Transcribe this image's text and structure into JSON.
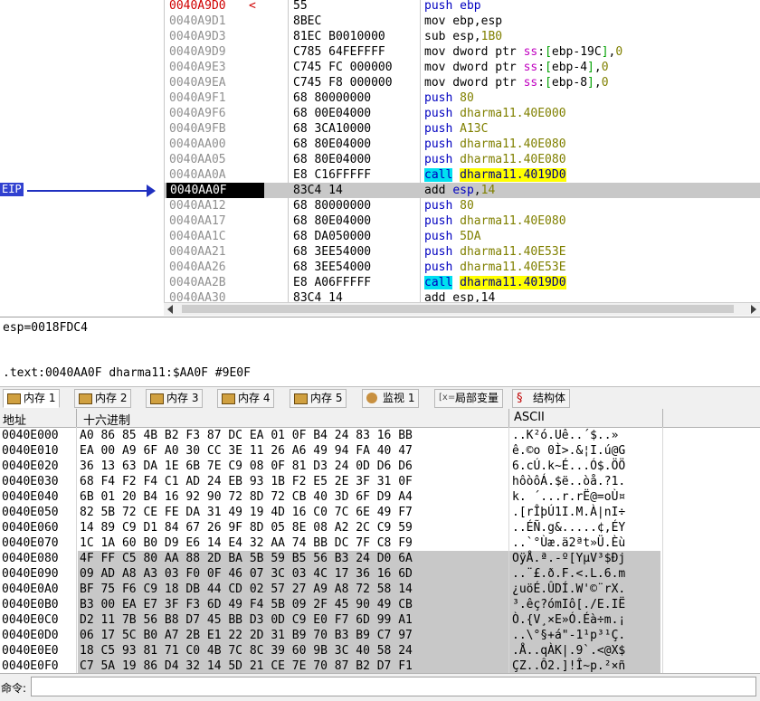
{
  "disasm": {
    "eip_label": "EIP",
    "rows": [
      {
        "addr": "0040A9D0",
        "arrow": "<",
        "bytes": "55",
        "ins": [
          [
            "kw",
            "push"
          ],
          [
            "t",
            " "
          ],
          [
            "kw",
            "ebp"
          ]
        ],
        "addr_red": true
      },
      {
        "addr": "0040A9D1",
        "bytes": "8BEC",
        "ins": [
          [
            "t",
            "mov ebp,esp"
          ]
        ]
      },
      {
        "addr": "0040A9D3",
        "bytes": "81EC B0010000",
        "ins": [
          [
            "t",
            "sub esp,"
          ],
          [
            "num",
            "1B0"
          ]
        ]
      },
      {
        "addr": "0040A9D9",
        "bytes": "C785 64FEFFFF",
        "ins": [
          [
            "t",
            "mov dword ptr "
          ],
          [
            "seg",
            "ss"
          ],
          [
            "t",
            ":"
          ],
          [
            "br",
            "["
          ],
          [
            "t",
            "ebp-19C"
          ],
          [
            "br",
            "]"
          ],
          [
            "t",
            ","
          ],
          [
            "num",
            "0"
          ]
        ]
      },
      {
        "addr": "0040A9E3",
        "bytes": "C745 FC 000000",
        "ins": [
          [
            "t",
            "mov dword ptr "
          ],
          [
            "seg",
            "ss"
          ],
          [
            "t",
            ":"
          ],
          [
            "br",
            "["
          ],
          [
            "t",
            "ebp-4"
          ],
          [
            "br",
            "]"
          ],
          [
            "t",
            ","
          ],
          [
            "num",
            "0"
          ]
        ]
      },
      {
        "addr": "0040A9EA",
        "bytes": "C745 F8 000000",
        "ins": [
          [
            "t",
            "mov dword ptr "
          ],
          [
            "seg",
            "ss"
          ],
          [
            "t",
            ":"
          ],
          [
            "br",
            "["
          ],
          [
            "t",
            "ebp-8"
          ],
          [
            "br",
            "]"
          ],
          [
            "t",
            ","
          ],
          [
            "num",
            "0"
          ]
        ]
      },
      {
        "addr": "0040A9F1",
        "bytes": "68 80000000",
        "ins": [
          [
            "kw",
            "push"
          ],
          [
            "t",
            " "
          ],
          [
            "ref",
            "80"
          ]
        ]
      },
      {
        "addr": "0040A9F6",
        "bytes": "68 00E04000",
        "ins": [
          [
            "kw",
            "push"
          ],
          [
            "t",
            " "
          ],
          [
            "ref",
            "dharma11.40E000"
          ]
        ]
      },
      {
        "addr": "0040A9FB",
        "bytes": "68 3CA10000",
        "ins": [
          [
            "kw",
            "push"
          ],
          [
            "t",
            " "
          ],
          [
            "ref",
            "A13C"
          ]
        ]
      },
      {
        "addr": "0040AA00",
        "bytes": "68 80E04000",
        "ins": [
          [
            "kw",
            "push"
          ],
          [
            "t",
            " "
          ],
          [
            "ref",
            "dharma11.40E080"
          ]
        ]
      },
      {
        "addr": "0040AA05",
        "bytes": "68 80E04000",
        "ins": [
          [
            "kw",
            "push"
          ],
          [
            "t",
            " "
          ],
          [
            "ref",
            "dharma11.40E080"
          ]
        ]
      },
      {
        "addr": "0040AA0A",
        "bytes": "E8 C16FFFFF",
        "ins": [
          [
            "kwcall",
            "call"
          ],
          [
            "t",
            " "
          ],
          [
            "refy",
            "dharma11.4019D0"
          ]
        ]
      },
      {
        "addr": "0040AA0F",
        "bytes": "83C4 14",
        "ins": [
          [
            "t",
            "add "
          ],
          [
            "kw",
            "esp"
          ],
          [
            "t",
            ","
          ],
          [
            "num",
            "14"
          ]
        ],
        "current": true
      },
      {
        "addr": "0040AA12",
        "bytes": "68 80000000",
        "ins": [
          [
            "kw",
            "push"
          ],
          [
            "t",
            " "
          ],
          [
            "ref",
            "80"
          ]
        ]
      },
      {
        "addr": "0040AA17",
        "bytes": "68 80E04000",
        "ins": [
          [
            "kw",
            "push"
          ],
          [
            "t",
            " "
          ],
          [
            "ref",
            "dharma11.40E080"
          ]
        ]
      },
      {
        "addr": "0040AA1C",
        "bytes": "68 DA050000",
        "ins": [
          [
            "kw",
            "push"
          ],
          [
            "t",
            " "
          ],
          [
            "ref",
            "5DA"
          ]
        ]
      },
      {
        "addr": "0040AA21",
        "bytes": "68 3EE54000",
        "ins": [
          [
            "kw",
            "push"
          ],
          [
            "t",
            " "
          ],
          [
            "ref",
            "dharma11.40E53E"
          ]
        ]
      },
      {
        "addr": "0040AA26",
        "bytes": "68 3EE54000",
        "ins": [
          [
            "kw",
            "push"
          ],
          [
            "t",
            " "
          ],
          [
            "ref",
            "dharma11.40E53E"
          ]
        ]
      },
      {
        "addr": "0040AA2B",
        "bytes": "E8 A06FFFFF",
        "ins": [
          [
            "kwcall",
            "call"
          ],
          [
            "t",
            " "
          ],
          [
            "refy",
            "dharma11.4019D0"
          ]
        ]
      },
      {
        "addr": "0040AA30",
        "bytes": "83C4 14",
        "ins": [
          [
            "t",
            "add esp,14"
          ]
        ]
      }
    ]
  },
  "info": {
    "line1": "esp=0018FDC4",
    "line2": ".text:0040AA0F dharma11:$AA0F #9E0F"
  },
  "tabs": [
    {
      "label": "内存 1",
      "icon": "memory-icon",
      "active": true
    },
    {
      "label": "内存 2",
      "icon": "memory-icon"
    },
    {
      "label": "内存 3",
      "icon": "memory-icon"
    },
    {
      "label": "内存 4",
      "icon": "memory-icon"
    },
    {
      "label": "内存 5",
      "icon": "memory-icon"
    },
    {
      "label": "监视 1",
      "icon": "watch-icon"
    },
    {
      "label": "局部变量",
      "icon": "local-vars-icon",
      "icon_text": "[x=]"
    },
    {
      "label": "结构体",
      "icon": "struct-icon",
      "icon_text": "§"
    }
  ],
  "dump": {
    "headers": {
      "address": "地址",
      "hex": "十六进制",
      "ascii": "ASCII"
    },
    "rows": [
      {
        "addr": "0040E000",
        "hex": "A0 86 85 4B B2 F3 87 DC EA 01 0F B4 24 83 16 BB",
        "ascii": "..K²ó.Uê..´$..»"
      },
      {
        "addr": "0040E010",
        "hex": "EA 00 A9 6F A0 30 CC 3E 11 26 A6 49 94 FA 40 47",
        "ascii": "ê.©o 0Ì>.&¦I.ú@G"
      },
      {
        "addr": "0040E020",
        "hex": "36 13 63 DA 1E 6B 7E C9 08 0F 81 D3 24 0D D6 D6",
        "ascii": "6.cÚ.k~É...Ó$.ÖÖ"
      },
      {
        "addr": "0040E030",
        "hex": "68 F4 F2 F4 C1 AD 24 EB 93 1B F2 E5 2E 3F 31 0F",
        "ascii": "hôòôÁ.$ë..òå.?1."
      },
      {
        "addr": "0040E040",
        "hex": "6B 01 20 B4 16 92 90 72 8D 72 CB 40 3D 6F D9 A4",
        "ascii": "k. ´...r.rË@=oÙ¤"
      },
      {
        "addr": "0040E050",
        "hex": "82 5B 72 CE FE DA 31 49 19 4D 16 C0 7C 6E 49 F7",
        "ascii": ".[rÎþÚ1I.M.À|nI÷"
      },
      {
        "addr": "0040E060",
        "hex": "14 89 C9 D1 84 67 26 9F 8D 05 8E 08 A2 2C C9 59",
        "ascii": "..ÉÑ.g&.....¢,ÉY"
      },
      {
        "addr": "0040E070",
        "hex": "1C 1A 60 B0 D9 E6 14 E4 32 AA 74 BB DC 7F C8 F9",
        "ascii": "..`°Ùæ.ä2ªt»Ü.Èù"
      },
      {
        "addr": "0040E080",
        "hex": "4F FF C5 80 AA 88 2D BA 5B 59 B5 56 B3 24 D0 6A",
        "ascii": "OÿÅ.ª.-º[YµV³$Ðj",
        "sel": true
      },
      {
        "addr": "0040E090",
        "hex": "09 AD A8 A3 03 F0 0F 46 07 3C 03 4C 17 36 16 6D",
        "ascii": "..¨£.ð.F.<.L.6.m",
        "sel": true
      },
      {
        "addr": "0040E0A0",
        "hex": "BF 75 F6 C9 18 DB 44 CD 02 57 27 A9 A8 72 58 14",
        "ascii": "¿uöÉ.ÛDÍ.W'©¨rX.",
        "sel": true
      },
      {
        "addr": "0040E0B0",
        "hex": "B3 00 EA E7 3F F3 6D 49 F4 5B 09 2F 45 90 49 CB",
        "ascii": "³.êç?ómIô[./E.IË",
        "sel": true
      },
      {
        "addr": "0040E0C0",
        "hex": "D2 11 7B 56 B8 D7 45 BB D3 0D C9 E0 F7 6D 99 A1",
        "ascii": "Ò.{V¸×E»Ó.Éà÷m.¡",
        "sel": true
      },
      {
        "addr": "0040E0D0",
        "hex": "06 17 5C B0 A7 2B E1 22 2D 31 B9 70 B3 B9 C7 97",
        "ascii": "..\\°§+á\"-1¹p³¹Ç.",
        "sel": true
      },
      {
        "addr": "0040E0E0",
        "hex": "18 C5 93 81 71 C0 4B 7C 8C 39 60 9B 3C 40 58 24",
        "ascii": ".Å..qÀK|.9`.<@X$",
        "sel": true
      },
      {
        "addr": "0040E0F0",
        "hex": "C7 5A 19 86 D4 32 14 5D 21 CE 7E 70 87 B2 D7 F1",
        "ascii": "ÇZ..Ô2.]!Î~p.²×ñ",
        "sel": true
      }
    ]
  },
  "command": {
    "label": "命令:",
    "value": ""
  }
}
